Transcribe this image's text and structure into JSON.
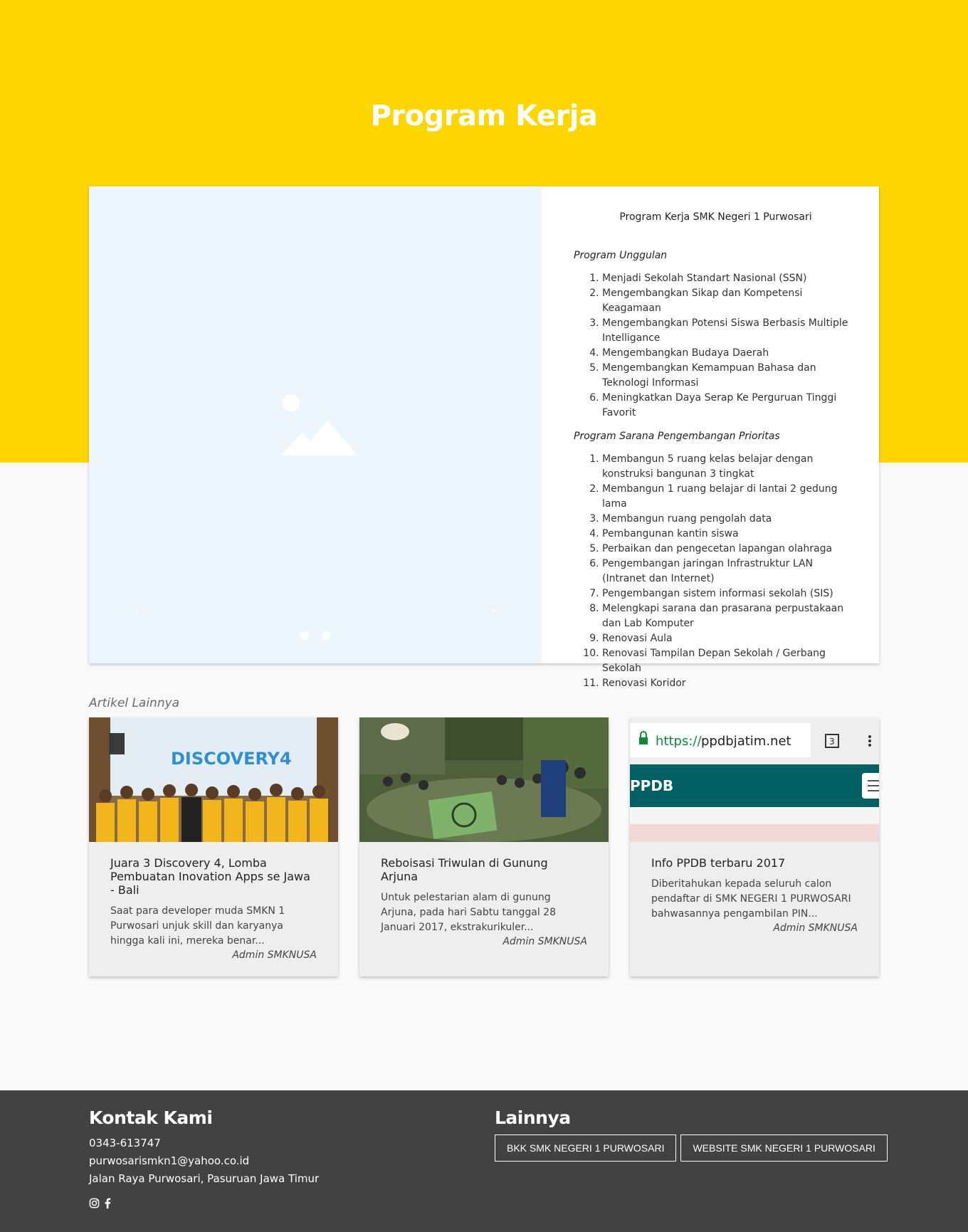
{
  "header": {
    "title": "Program Kerja"
  },
  "carousel": {
    "prev_label": "‹",
    "next_label": "›",
    "slides": 2
  },
  "content": {
    "heading": "Program Kerja SMK Negeri 1 Purwosari",
    "section1_title": "Program Unggulan",
    "section1_items": [
      "Menjadi Sekolah Standart Nasional (SSN)",
      "Mengembangkan Sikap dan Kompetensi Keagamaan",
      "Mengembangkan Potensi Siswa Berbasis Multiple Intelligance",
      "Mengembangkan Budaya Daerah",
      "Mengembangkan Kemampuan Bahasa dan Teknologi Informasi",
      "Meningkatkan Daya Serap Ke Perguruan Tinggi Favorit"
    ],
    "section2_title": "Program Sarana Pengembangan Prioritas",
    "section2_items": [
      "Membangun 5 ruang kelas belajar dengan konstruksi bangunan 3 tingkat",
      "Membangun 1 ruang belajar di lantai 2 gedung lama",
      "Membangun ruang pengolah data",
      "Pembangunan kantin siswa",
      "Perbaikan dan pengecetan lapangan olahraga",
      "Pengembangan jaringan Infrastruktur LAN (Intranet dan Internet)",
      "Pengembangan sistem informasi sekolah (SIS)",
      "Melengkapi sarana dan prasarana perpustakaan dan Lab Komputer",
      "Renovasi Aula",
      "Renovasi Tampilan Depan Sekolah / Gerbang Sekolah",
      "Renovasi Koridor"
    ]
  },
  "articles_section": {
    "label": "Artikel Lainnya",
    "items": [
      {
        "title": "Juara 3 Discovery 4, Lomba Pembuatan Inovation Apps se Jawa - Bali",
        "excerpt": "Saat para developer muda SMKN 1 Purwosari unjuk skill dan karyanya hingga kali ini, mereka benar...",
        "author": "Admin SMKNUSA",
        "thumb_text": "DISCOVERY4"
      },
      {
        "title": "Reboisasi Triwulan di Gunung Arjuna",
        "excerpt": "Untuk pelestarian alam di gunung Arjuna, pada hari Sabtu tanggal 28 Januari 2017, ekstrakurikuler...",
        "author": "Admin SMKNUSA"
      },
      {
        "title": "Info PPDB terbaru 2017",
        "excerpt": "Diberitahukan kepada seluruh calon pendaftar di SMK NEGERI 1 PURWOSARI bahwasannya pengambilan PIN...",
        "author": "Admin SMKNUSA",
        "thumb_url_scheme": "https://",
        "thumb_url_host": "ppdbjatim.net",
        "thumb_tab_count": "3",
        "thumb_brand": "PPDB"
      }
    ]
  },
  "footer": {
    "contact_title": "Kontak Kami",
    "phone": "0343-613747",
    "email": "purwosarismkn1@yahoo.co.id",
    "address": "Jalan Raya Purwosari, Pasuruan Jawa Timur",
    "others_title": "Lainnya",
    "buttons": [
      "BKK SMK NEGERI 1 PURWOSARI",
      "WEBSITE SMK NEGERI 1 PURWOSARI"
    ]
  },
  "colors": {
    "accent": "#ffd600",
    "footer_bg": "#424242",
    "carousel_bg": "#eef6fd",
    "ppdb_teal": "#006064"
  },
  "icons": [
    "image-placeholder-icon",
    "instagram-icon",
    "facebook-icon",
    "lock-icon",
    "menu-icon"
  ]
}
